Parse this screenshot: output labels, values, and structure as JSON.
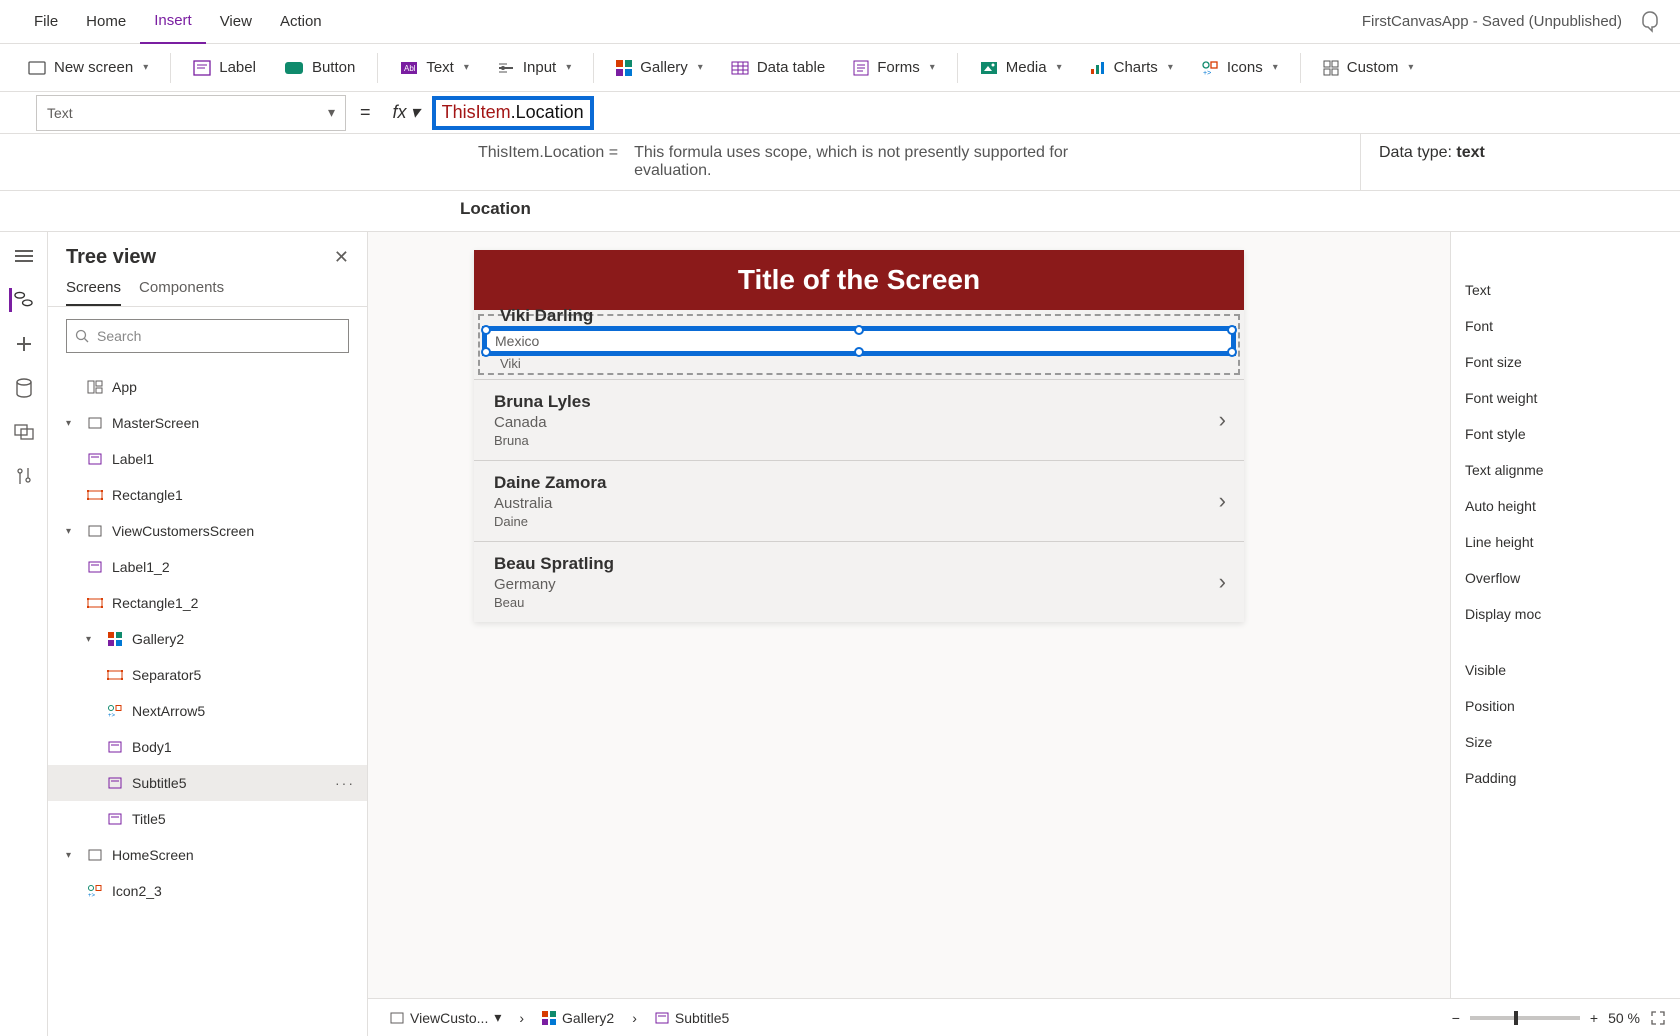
{
  "menu": {
    "file": "File",
    "home": "Home",
    "insert": "Insert",
    "view": "View",
    "action": "Action"
  },
  "app_status": "FirstCanvasApp - Saved (Unpublished)",
  "ribbon": {
    "new_screen": "New screen",
    "label": "Label",
    "button": "Button",
    "text": "Text",
    "input": "Input",
    "gallery": "Gallery",
    "data_table": "Data table",
    "forms": "Forms",
    "media": "Media",
    "charts": "Charts",
    "icons": "Icons",
    "custom": "Custom"
  },
  "formula": {
    "property": "Text",
    "equals": "=",
    "fx": "fx",
    "token_obj": "ThisItem",
    "token_dot": ".",
    "token_field": "Location",
    "help_expr": "ThisItem.Location  =",
    "help_desc": "This formula uses scope, which is not presently supported for evaluation.",
    "data_type_label": "Data type:",
    "data_type_value": "text",
    "result_label": "Location"
  },
  "tree": {
    "title": "Tree view",
    "tab_screens": "Screens",
    "tab_components": "Components",
    "search_placeholder": "Search",
    "items": {
      "app": "App",
      "master": "MasterScreen",
      "label1": "Label1",
      "rect1": "Rectangle1",
      "viewcust": "ViewCustomersScreen",
      "label1_2": "Label1_2",
      "rect1_2": "Rectangle1_2",
      "gallery2": "Gallery2",
      "sep5": "Separator5",
      "nextarrow5": "NextArrow5",
      "body1": "Body1",
      "subtitle5": "Subtitle5",
      "title5": "Title5",
      "home": "HomeScreen",
      "icon2_3": "Icon2_3"
    }
  },
  "canvas": {
    "screen_title": "Title of the Screen",
    "items": [
      {
        "name": "Viki Darling",
        "loc": "Mexico",
        "body": "Viki"
      },
      {
        "name": "Bruna Lyles",
        "loc": "Canada",
        "body": "Bruna"
      },
      {
        "name": "Daine Zamora",
        "loc": "Australia",
        "body": "Daine"
      },
      {
        "name": "Beau Spratling",
        "loc": "Germany",
        "body": "Beau"
      }
    ]
  },
  "props": {
    "text": "Text",
    "font": "Font",
    "font_size": "Font size",
    "font_weight": "Font weight",
    "font_style": "Font style",
    "text_align": "Text alignme",
    "auto_height": "Auto height",
    "line_height": "Line height",
    "overflow": "Overflow",
    "display_mode": "Display moc",
    "visible": "Visible",
    "position": "Position",
    "size": "Size",
    "padding": "Padding"
  },
  "breadcrumb": {
    "screen": "ViewCusto...",
    "gallery": "Gallery2",
    "control": "Subtitle5"
  },
  "zoom": {
    "minus": "−",
    "plus": "+",
    "value": "50 %"
  }
}
